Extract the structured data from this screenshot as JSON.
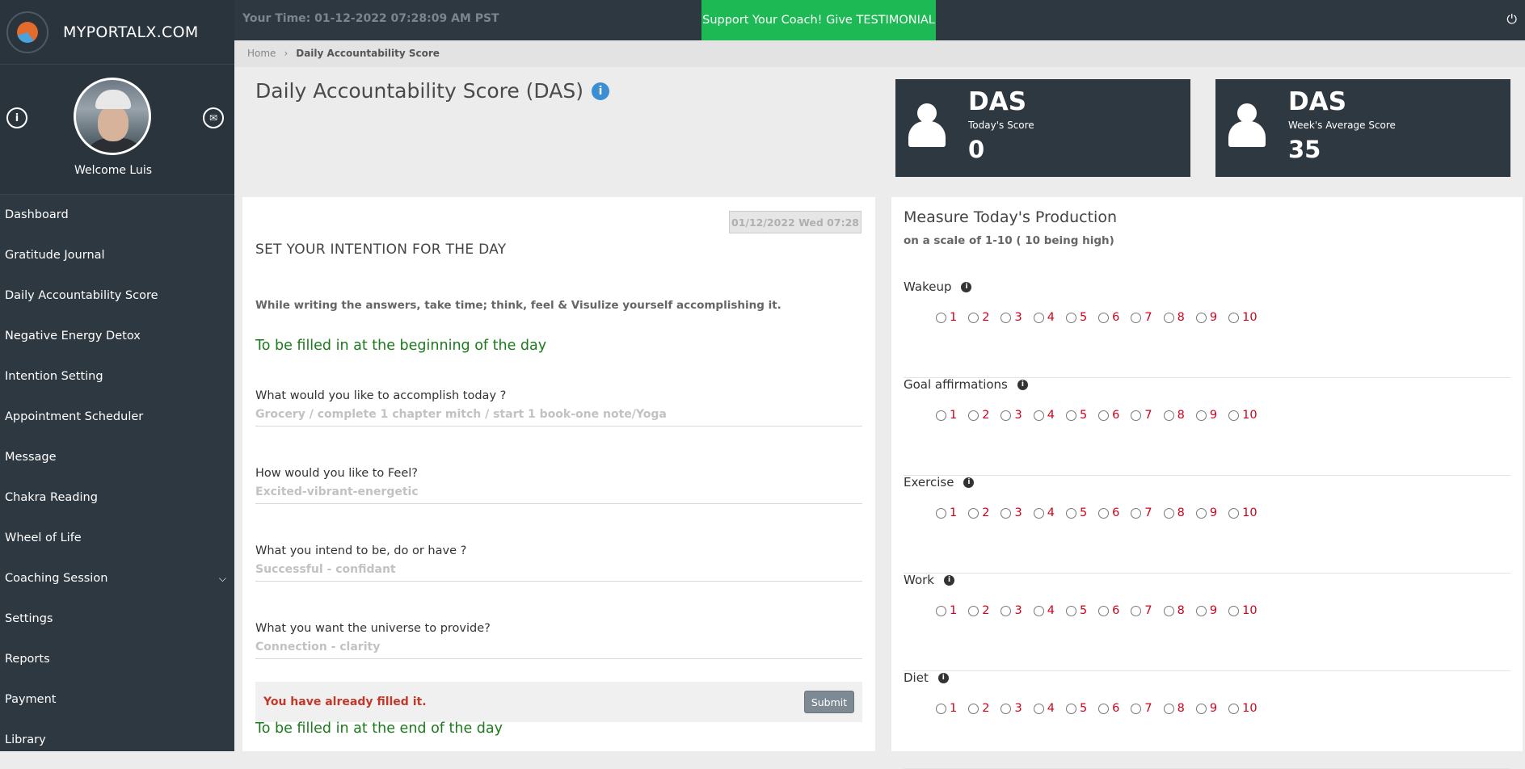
{
  "brand": {
    "name": "MYPORTALX.COM"
  },
  "profile": {
    "welcome": "Welcome Luis",
    "info_icon": "i",
    "mail_icon": "✉"
  },
  "nav": [
    {
      "label": "Dashboard"
    },
    {
      "label": "Gratitude Journal"
    },
    {
      "label": "Daily Accountability Score"
    },
    {
      "label": "Negative Energy Detox"
    },
    {
      "label": "Intention Setting"
    },
    {
      "label": "Appointment Scheduler"
    },
    {
      "label": "Message"
    },
    {
      "label": "Chakra Reading"
    },
    {
      "label": "Wheel of Life"
    },
    {
      "label": "Coaching Session",
      "has_chevron": true
    },
    {
      "label": "Settings"
    },
    {
      "label": "Reports"
    },
    {
      "label": "Payment"
    },
    {
      "label": "Library"
    }
  ],
  "topbar": {
    "your_time": "Your Time: 01-12-2022 07:28:09 AM PST",
    "support_button": "Support Your Coach! Give TESTIMONIAL",
    "power_icon": "⏻"
  },
  "breadcrumb": {
    "home": "Home",
    "current": "Daily Accountability Score"
  },
  "page": {
    "title": "Daily Accountability Score (DAS)",
    "info_icon": "i"
  },
  "cards": [
    {
      "title": "DAS",
      "label": "Today's Score",
      "value": "0"
    },
    {
      "title": "DAS",
      "label": "Week's Average Score",
      "value": "35"
    }
  ],
  "intention": {
    "date": "01/12/2022 Wed 07:28",
    "heading": "SET YOUR INTENTION FOR THE DAY",
    "note": "While writing the answers, take time; think, feel & Visulize yourself accomplishing it.",
    "section_begin": "To be filled in at the beginning of the day",
    "questions": [
      {
        "q": "What would you like to accomplish today ?",
        "a": "Grocery / complete 1 chapter mitch / start 1 book-one note/Yoga"
      },
      {
        "q": "How would you like to Feel?",
        "a": "Excited-vibrant-energetic"
      },
      {
        "q": "What you intend to be, do or have ?",
        "a": "Successful - confidant"
      },
      {
        "q": "What you want the universe to provide?",
        "a": "Connection - clarity"
      }
    ],
    "filled_msg": "You have already filled it.",
    "submit": "Submit",
    "section_end": "To be filled in at the end of the day"
  },
  "production": {
    "title": "Measure Today's Production",
    "subtitle": "on a scale of 1-10 ( 10 being high)",
    "info_icon": "i",
    "scale": [
      "1",
      "2",
      "3",
      "4",
      "5",
      "6",
      "7",
      "8",
      "9",
      "10"
    ],
    "metrics": [
      {
        "name": "Wakeup"
      },
      {
        "name": "Goal affirmations"
      },
      {
        "name": "Exercise"
      },
      {
        "name": "Work"
      },
      {
        "name": "Diet"
      }
    ]
  }
}
